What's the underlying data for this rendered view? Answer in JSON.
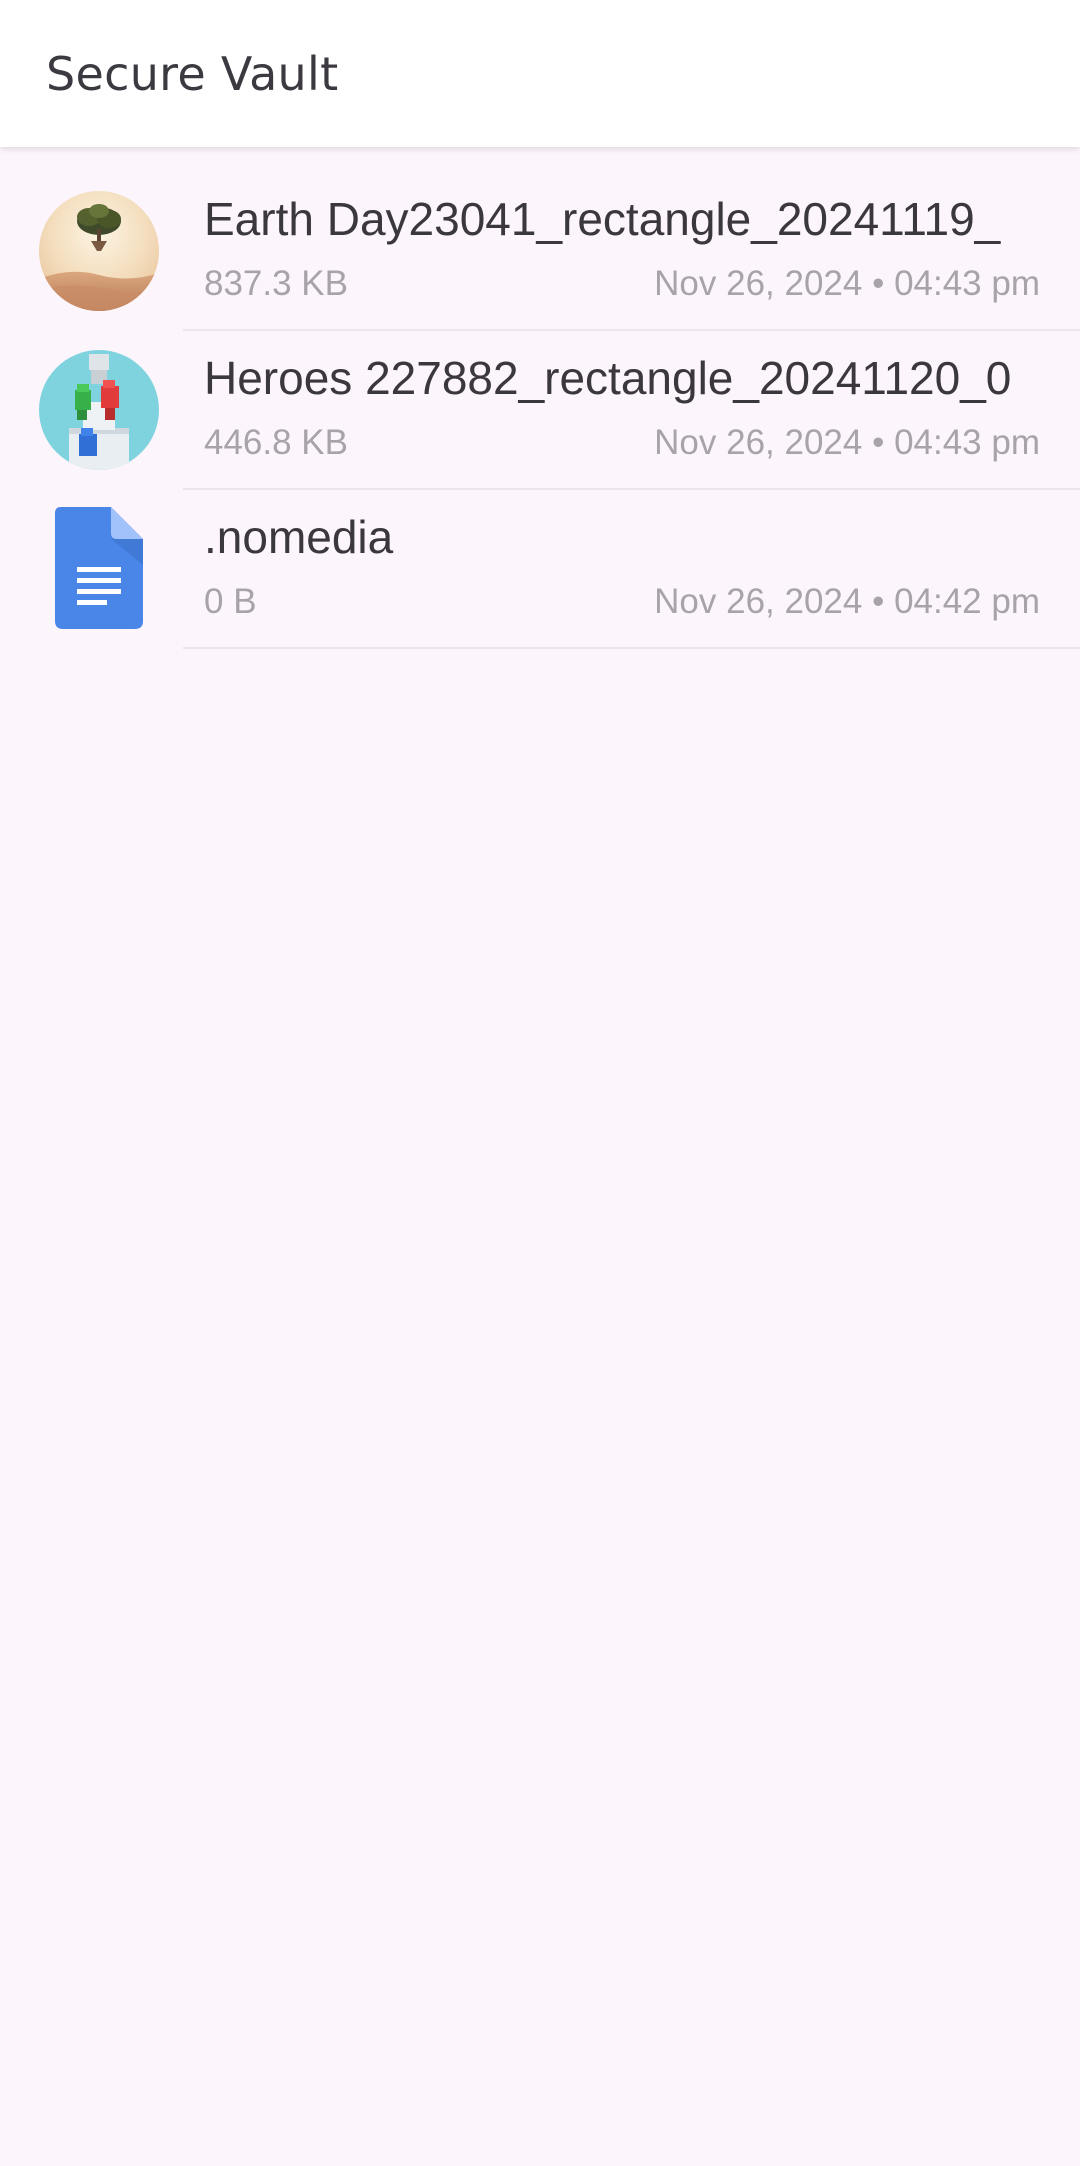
{
  "app_bar": {
    "title": "Secure Vault"
  },
  "files": [
    {
      "name": "Earth Day23041_rectangle_20241119_",
      "size": "837.3 KB",
      "date": "Nov 26, 2024 • 04:43 pm",
      "icon": "image-thumbnail-tree"
    },
    {
      "name": "Heroes 227882_rectangle_20241120_0",
      "size": "446.8 KB",
      "date": "Nov 26, 2024 • 04:43 pm",
      "icon": "image-thumbnail-heroes"
    },
    {
      "name": ".nomedia",
      "size": "0 B",
      "date": "Nov 26, 2024 • 04:42 pm",
      "icon": "document-icon"
    }
  ],
  "colors": {
    "background": "#fcf5fc",
    "app_bar": "#ffffff",
    "title_text": "#3c3a40",
    "primary_text": "#3b383d",
    "secondary_text": "#a8a3ab",
    "doc_icon_blue": "#4a86e8"
  }
}
